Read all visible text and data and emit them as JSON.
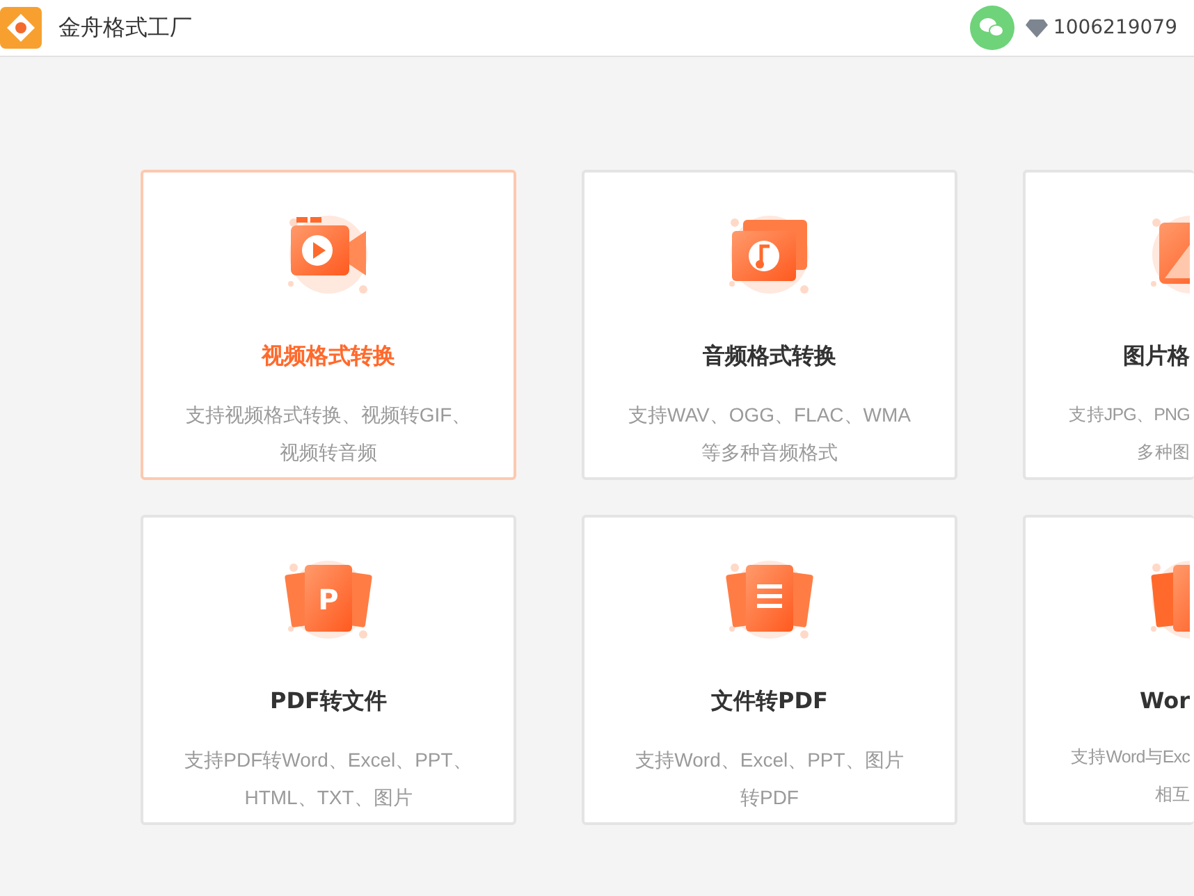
{
  "header": {
    "title": "金舟格式工厂",
    "account": "1006219079"
  },
  "cards": [
    {
      "kind": "video",
      "title": "视频格式转换",
      "description": [
        "支持视频格式转换、视频转GIF、",
        "视频转音频"
      ],
      "selected": true,
      "cut": false
    },
    {
      "kind": "audio",
      "title": "音频格式转换",
      "description": [
        "支持WAV、OGG、FLAC、WMA",
        "等多种音频格式"
      ],
      "selected": false,
      "cut": false
    },
    {
      "kind": "image",
      "title": "图片格",
      "description": [
        "支持JPG、PNG",
        "多种图"
      ],
      "selected": false,
      "cut": true
    },
    {
      "kind": "pdf",
      "icon_text": "P",
      "title": "PDF转文件",
      "description": [
        "支持PDF转Word、Excel、PPT、",
        "HTML、TXT、图片"
      ],
      "selected": false,
      "cut": false
    },
    {
      "kind": "document",
      "title": "文件转PDF",
      "description": [
        "支持Word、Excel、PPT、图片",
        "转PDF"
      ],
      "selected": false,
      "cut": false
    },
    {
      "kind": "word",
      "title": "Wor",
      "description": [
        "支持Word与Exc",
        "相互"
      ],
      "selected": false,
      "cut": true
    }
  ]
}
